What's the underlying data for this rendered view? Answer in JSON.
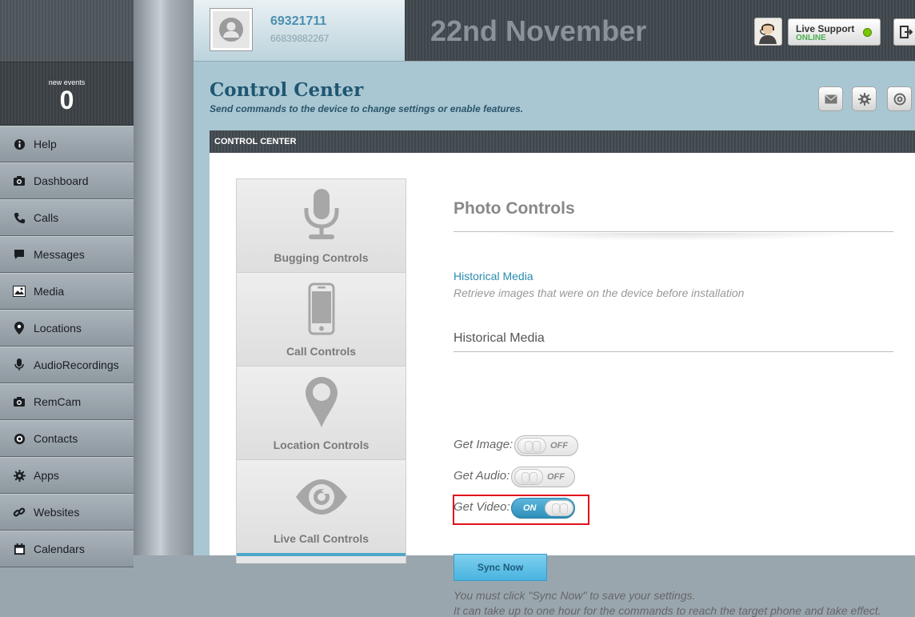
{
  "sidebar": {
    "events": {
      "label": "new events",
      "count": "0"
    },
    "items": [
      {
        "label": "Help",
        "icon": "info-icon"
      },
      {
        "label": "Dashboard",
        "icon": "camera-icon"
      },
      {
        "label": "Calls",
        "icon": "phone-icon"
      },
      {
        "label": "Messages",
        "icon": "message-icon"
      },
      {
        "label": "Media",
        "icon": "image-icon"
      },
      {
        "label": "Locations",
        "icon": "map-pin-icon"
      },
      {
        "label": "AudioRecordings",
        "icon": "microphone-icon"
      },
      {
        "label": "RemCam",
        "icon": "camera-icon"
      },
      {
        "label": "Contacts",
        "icon": "contacts-icon"
      },
      {
        "label": "Apps",
        "icon": "gear-icon"
      },
      {
        "label": "Websites",
        "icon": "link-icon"
      },
      {
        "label": "Calendars",
        "icon": "calendar-icon"
      }
    ]
  },
  "header": {
    "device_id": "69321711",
    "device_phone": "66839882267",
    "date": "22nd November",
    "support": {
      "title": "Live Support",
      "status": "ONLINE"
    }
  },
  "page": {
    "title": "Control Center",
    "subtitle": "Send commands to the device to change settings or enable features.",
    "panel_title": "CONTROL CENTER"
  },
  "controls_nav": [
    {
      "label": "Bugging Controls",
      "icon": "microphone-icon"
    },
    {
      "label": "Call Controls",
      "icon": "smartphone-icon"
    },
    {
      "label": "Location Controls",
      "icon": "map-pin-icon"
    },
    {
      "label": "Live Call Controls",
      "icon": "eye-icon"
    }
  ],
  "main": {
    "section_title": "Photo Controls",
    "historical_link": "Historical Media",
    "historical_desc": "Retrieve images that were on the device before installation",
    "subsection_title": "Historical Media",
    "toggles": [
      {
        "label": "Get Image:",
        "state": "OFF"
      },
      {
        "label": "Get Audio:",
        "state": "OFF"
      },
      {
        "label": "Get Video:",
        "state": "ON"
      }
    ],
    "sync_button": "Sync Now",
    "note_line1": "You must click \"Sync Now\" to save your settings.",
    "note_line2": "It can take up to one hour for the commands to reach the target phone and take effect."
  },
  "colors": {
    "accent": "#4ca6c9",
    "highlight": "#e0101b",
    "online": "#78c800"
  }
}
